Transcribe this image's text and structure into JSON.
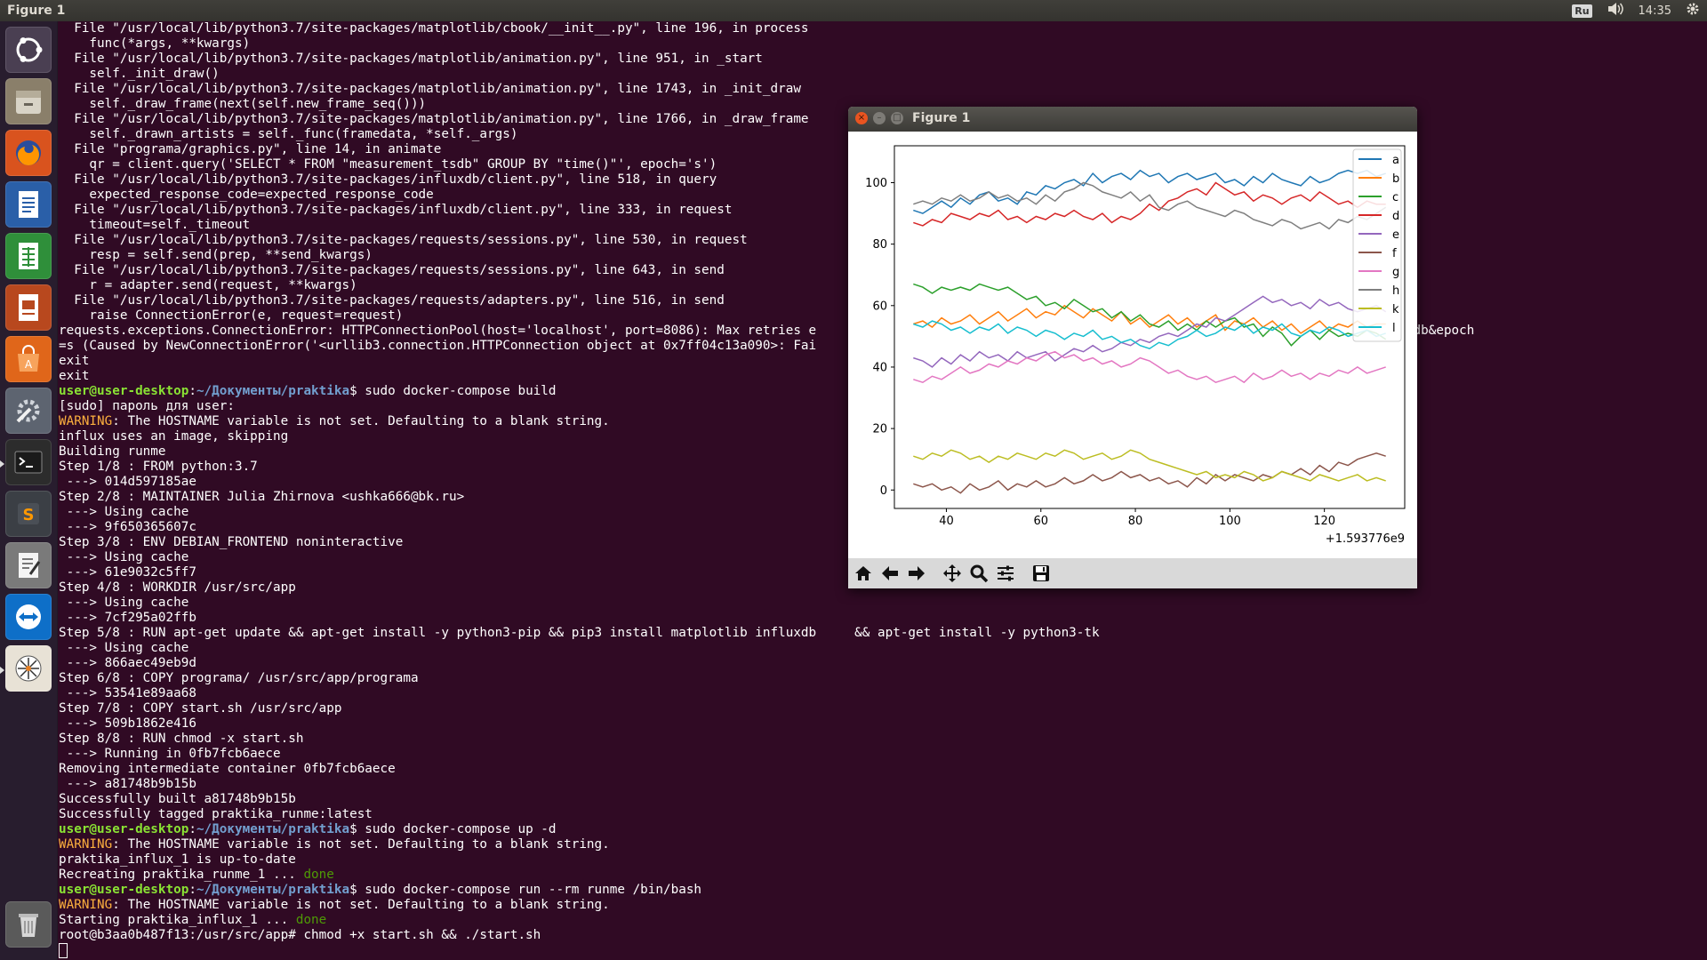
{
  "top_panel": {
    "title": "Figure 1",
    "keyboard_layout": "Ru",
    "clock": "14:35"
  },
  "launcher": {
    "items": [
      "ubuntu-dash",
      "files",
      "firefox",
      "libreoffice-writer",
      "libreoffice-calc",
      "libreoffice-impress",
      "software-center",
      "system-settings",
      "terminal",
      "sublime-text",
      "text-editor",
      "teamviewer",
      "inkscape-like-app",
      "trash"
    ]
  },
  "terminal": {
    "lines": [
      [
        [
          "t",
          "  File \"/usr/local/lib/python3.7/site-packages/matplotlib/cbook/__init__.py\", line 196, in process"
        ]
      ],
      [
        [
          "t",
          "    func(*args, **kwargs)"
        ]
      ],
      [
        [
          "t",
          "  File \"/usr/local/lib/python3.7/site-packages/matplotlib/animation.py\", line 951, in _start"
        ]
      ],
      [
        [
          "t",
          "    self._init_draw()"
        ]
      ],
      [
        [
          "t",
          "  File \"/usr/local/lib/python3.7/site-packages/matplotlib/animation.py\", line 1743, in _init_draw"
        ]
      ],
      [
        [
          "t",
          "    self._draw_frame(next(self.new_frame_seq()))"
        ]
      ],
      [
        [
          "t",
          "  File \"/usr/local/lib/python3.7/site-packages/matplotlib/animation.py\", line 1766, in _draw_frame"
        ]
      ],
      [
        [
          "t",
          "    self._drawn_artists = self._func(framedata, *self._args)"
        ]
      ],
      [
        [
          "t",
          "  File \"programa/graphics.py\", line 14, in animate"
        ]
      ],
      [
        [
          "t",
          "    qr = client.query('SELECT * FROM \"measurement_tsdb\" GROUP BY \"time()\"', epoch='s')"
        ]
      ],
      [
        [
          "t",
          "  File \"/usr/local/lib/python3.7/site-packages/influxdb/client.py\", line 518, in query"
        ]
      ],
      [
        [
          "t",
          "    expected_response_code=expected_response_code"
        ]
      ],
      [
        [
          "t",
          "  File \"/usr/local/lib/python3.7/site-packages/influxdb/client.py\", line 333, in request"
        ]
      ],
      [
        [
          "t",
          "    timeout=self._timeout"
        ]
      ],
      [
        [
          "t",
          "  File \"/usr/local/lib/python3.7/site-packages/requests/sessions.py\", line 530, in request"
        ]
      ],
      [
        [
          "t",
          "    resp = self.send(prep, **send_kwargs)"
        ]
      ],
      [
        [
          "t",
          "  File \"/usr/local/lib/python3.7/site-packages/requests/sessions.py\", line 643, in send"
        ]
      ],
      [
        [
          "t",
          "    r = adapter.send(request, **kwargs)"
        ]
      ],
      [
        [
          "t",
          "  File \"/usr/local/lib/python3.7/site-packages/requests/adapters.py\", line 516, in send"
        ]
      ],
      [
        [
          "t",
          "    raise ConnectionError(e, request=request)"
        ]
      ],
      [
        [
          "t",
          "requests.exceptions.ConnectionError: HTTPConnectionPool(host='localhost', port=8086): Max retries e                                                    +BY+%22time%28%29%22&db=tsdb&epoch"
        ]
      ],
      [
        [
          "t",
          "=s (Caused by NewConnectionError('<urllib3.connection.HTTPConnection object at 0x7ff04c13a090>: Fai"
        ]
      ],
      [
        [
          "t",
          "exit"
        ]
      ],
      [
        [
          "t",
          "exit"
        ]
      ],
      [
        [
          "pr",
          "user@user-desktop"
        ],
        [
          "t",
          ":"
        ],
        [
          "pa",
          "~/Документы/praktika"
        ],
        [
          "t",
          "$ sudo docker-compose build"
        ]
      ],
      [
        [
          "t",
          "[sudo] пароль для user:"
        ]
      ],
      [
        [
          "warn",
          "WARNING"
        ],
        [
          "t",
          ": The HOSTNAME variable is not set. Defaulting to a blank string."
        ]
      ],
      [
        [
          "t",
          "influx uses an image, skipping"
        ]
      ],
      [
        [
          "t",
          "Building runme"
        ]
      ],
      [
        [
          "t",
          "Step 1/8 : FROM python:3.7"
        ]
      ],
      [
        [
          "t",
          " ---> 014d597185ae"
        ]
      ],
      [
        [
          "t",
          "Step 2/8 : MAINTAINER Julia Zhirnova <ushka666@bk.ru>"
        ]
      ],
      [
        [
          "t",
          " ---> Using cache"
        ]
      ],
      [
        [
          "t",
          " ---> 9f650365607c"
        ]
      ],
      [
        [
          "t",
          "Step 3/8 : ENV DEBIAN_FRONTEND noninteractive"
        ]
      ],
      [
        [
          "t",
          " ---> Using cache"
        ]
      ],
      [
        [
          "t",
          " ---> 61e9032c5ff7"
        ]
      ],
      [
        [
          "t",
          "Step 4/8 : WORKDIR /usr/src/app"
        ]
      ],
      [
        [
          "t",
          " ---> Using cache"
        ]
      ],
      [
        [
          "t",
          " ---> 7cf295a02ffb"
        ]
      ],
      [
        [
          "t",
          "Step 5/8 : RUN apt-get update && apt-get install -y python3-pip && pip3 install matplotlib influxdb     && apt-get install -y python3-tk"
        ]
      ],
      [
        [
          "t",
          " ---> Using cache"
        ]
      ],
      [
        [
          "t",
          " ---> 866aec49eb9d"
        ]
      ],
      [
        [
          "t",
          "Step 6/8 : COPY programa/ /usr/src/app/programa"
        ]
      ],
      [
        [
          "t",
          " ---> 53541e89aa68"
        ]
      ],
      [
        [
          "t",
          "Step 7/8 : COPY start.sh /usr/src/app"
        ]
      ],
      [
        [
          "t",
          " ---> 509b1862e416"
        ]
      ],
      [
        [
          "t",
          "Step 8/8 : RUN chmod -x start.sh"
        ]
      ],
      [
        [
          "t",
          " ---> Running in 0fb7fcb6aece"
        ]
      ],
      [
        [
          "t",
          "Removing intermediate container 0fb7fcb6aece"
        ]
      ],
      [
        [
          "t",
          " ---> a81748b9b15b"
        ]
      ],
      [
        [
          "t",
          "Successfully built a81748b9b15b"
        ]
      ],
      [
        [
          "t",
          "Successfully tagged praktika_runme:latest"
        ]
      ],
      [
        [
          "pr",
          "user@user-desktop"
        ],
        [
          "t",
          ":"
        ],
        [
          "pa",
          "~/Документы/praktika"
        ],
        [
          "t",
          "$ sudo docker-compose up -d"
        ]
      ],
      [
        [
          "warn",
          "WARNING"
        ],
        [
          "t",
          ": The HOSTNAME variable is not set. Defaulting to a blank string."
        ]
      ],
      [
        [
          "t",
          "praktika_influx_1 is up-to-date"
        ]
      ],
      [
        [
          "t",
          "Recreating praktika_runme_1 ... "
        ],
        [
          "done",
          "done"
        ]
      ],
      [
        [
          "pr",
          "user@user-desktop"
        ],
        [
          "t",
          ":"
        ],
        [
          "pa",
          "~/Документы/praktika"
        ],
        [
          "t",
          "$ sudo docker-compose run --rm runme /bin/bash"
        ]
      ],
      [
        [
          "warn",
          "WARNING"
        ],
        [
          "t",
          ": The HOSTNAME variable is not set. Defaulting to a blank string."
        ]
      ],
      [
        [
          "t",
          "Starting praktika_influx_1 ... "
        ],
        [
          "done",
          "done"
        ]
      ],
      [
        [
          "t",
          "root@b3aa0b487f13:/usr/src/app# chmod +x start.sh && ./start.sh"
        ]
      ]
    ]
  },
  "figure_window": {
    "title": "Figure 1",
    "toolbar": [
      "home-icon",
      "back-arrow-icon",
      "forward-arrow-icon",
      "pan-icon",
      "zoom-icon",
      "subplots-config-icon",
      "save-icon"
    ]
  },
  "chart_data": {
    "type": "line",
    "x_offset_label": "+1.593776e9",
    "xlim": [
      29,
      137
    ],
    "ylim": [
      -6,
      112
    ],
    "xticks": [
      40,
      60,
      80,
      100,
      120
    ],
    "yticks": [
      0,
      20,
      40,
      60,
      80,
      100
    ],
    "grid": false,
    "legend_position": "top-right",
    "x_start": 33,
    "x_step": 2,
    "series": [
      {
        "name": "a",
        "color": "#1f77b4",
        "values": [
          91,
          90,
          92,
          94,
          92,
          95,
          93,
          96,
          97,
          94,
          95,
          93,
          97,
          96,
          99,
          98,
          100,
          101,
          99,
          103,
          100,
          102,
          103,
          101,
          104,
          102,
          103,
          100,
          102,
          103,
          101,
          102,
          103,
          100,
          101,
          99,
          102,
          100,
          103,
          101,
          100,
          99,
          102,
          100,
          101,
          103,
          104,
          103,
          104,
          102,
          103
        ]
      },
      {
        "name": "b",
        "color": "#ff7f0e",
        "values": [
          54,
          55,
          53,
          56,
          54,
          55,
          57,
          54,
          56,
          58,
          55,
          57,
          59,
          56,
          58,
          57,
          60,
          58,
          56,
          59,
          57,
          55,
          58,
          54,
          56,
          53,
          55,
          57,
          54,
          56,
          53,
          55,
          57,
          52,
          55,
          54,
          56,
          53,
          55,
          52,
          54,
          51,
          53,
          55,
          52,
          54,
          53,
          55,
          53,
          54,
          54
        ]
      },
      {
        "name": "c",
        "color": "#2ca02c",
        "values": [
          67,
          66,
          64,
          66,
          65,
          66,
          65,
          67,
          66,
          65,
          66,
          64,
          62,
          63,
          60,
          61,
          59,
          62,
          60,
          58,
          59,
          56,
          58,
          55,
          57,
          54,
          53,
          55,
          52,
          54,
          52,
          55,
          53,
          55,
          56,
          53,
          54,
          50,
          53,
          51,
          47,
          50,
          52,
          49,
          52,
          50,
          51,
          50,
          52,
          51,
          49
        ]
      },
      {
        "name": "d",
        "color": "#d62728",
        "values": [
          87,
          86,
          88,
          87,
          90,
          89,
          88,
          90,
          89,
          91,
          88,
          89,
          87,
          89,
          88,
          90,
          89,
          91,
          89,
          88,
          90,
          87,
          89,
          88,
          90,
          93,
          91,
          94,
          95,
          97,
          98,
          96,
          100,
          98,
          96,
          97,
          94,
          96,
          95,
          93,
          95,
          96,
          94,
          97,
          95,
          93,
          94,
          92,
          94,
          93,
          93
        ]
      },
      {
        "name": "e",
        "color": "#9467bd",
        "values": [
          43,
          42,
          40,
          43,
          41,
          44,
          42,
          45,
          43,
          44,
          42,
          45,
          43,
          44,
          45,
          42,
          44,
          46,
          45,
          47,
          45,
          46,
          48,
          47,
          49,
          48,
          50,
          51,
          50,
          52,
          54,
          53,
          56,
          55,
          57,
          59,
          61,
          63,
          61,
          62,
          60,
          61,
          59,
          62,
          60,
          61,
          59,
          58,
          59,
          60,
          58
        ]
      },
      {
        "name": "f",
        "color": "#8c564b",
        "values": [
          2,
          1,
          2,
          0,
          1,
          -1,
          2,
          0,
          1,
          3,
          0,
          2,
          1,
          3,
          1,
          2,
          4,
          2,
          3,
          5,
          3,
          4,
          6,
          4,
          5,
          3,
          4,
          2,
          3,
          1,
          4,
          2,
          5,
          3,
          5,
          4,
          3,
          5,
          4,
          6,
          5,
          7,
          5,
          8,
          6,
          9,
          8,
          10,
          11,
          12,
          11
        ]
      },
      {
        "name": "g",
        "color": "#e377c2",
        "values": [
          36,
          35,
          37,
          36,
          38,
          40,
          38,
          39,
          41,
          40,
          42,
          41,
          43,
          42,
          44,
          45,
          43,
          44,
          42,
          43,
          41,
          42,
          40,
          41,
          43,
          42,
          40,
          38,
          39,
          37,
          36,
          37,
          35,
          36,
          37,
          35,
          38,
          36,
          37,
          39,
          37,
          38,
          36,
          38,
          37,
          39,
          38,
          40,
          38,
          39,
          40
        ]
      },
      {
        "name": "h",
        "color": "#7f7f7f",
        "values": [
          93,
          94,
          93,
          95,
          94,
          96,
          94,
          95,
          97,
          95,
          96,
          94,
          95,
          93,
          96,
          94,
          97,
          98,
          100,
          99,
          97,
          96,
          95,
          97,
          94,
          96,
          92,
          91,
          93,
          94,
          92,
          91,
          90,
          89,
          91,
          90,
          88,
          87,
          86,
          88,
          87,
          85,
          86,
          87,
          85,
          88,
          87,
          89,
          88,
          90,
          92
        ]
      },
      {
        "name": "k",
        "color": "#bcbd22",
        "values": [
          11,
          10,
          12,
          11,
          13,
          12,
          10,
          11,
          9,
          11,
          10,
          12,
          11,
          10,
          12,
          11,
          13,
          12,
          10,
          11,
          12,
          10,
          11,
          13,
          12,
          10,
          9,
          8,
          7,
          6,
          5,
          6,
          4,
          5,
          4,
          6,
          5,
          3,
          4,
          6,
          5,
          4,
          3,
          5,
          4,
          3,
          4,
          5,
          3,
          4,
          3
        ]
      },
      {
        "name": "l",
        "color": "#17becf",
        "values": [
          54,
          53,
          55,
          54,
          52,
          53,
          51,
          53,
          52,
          54,
          51,
          53,
          52,
          50,
          52,
          51,
          49,
          51,
          50,
          52,
          49,
          50,
          48,
          49,
          47,
          46,
          48,
          47,
          49,
          50,
          52,
          50,
          51,
          53,
          52,
          54,
          51,
          53,
          52,
          54,
          51,
          50,
          52,
          51,
          53,
          52,
          50,
          51,
          52,
          50,
          51
        ]
      }
    ]
  }
}
